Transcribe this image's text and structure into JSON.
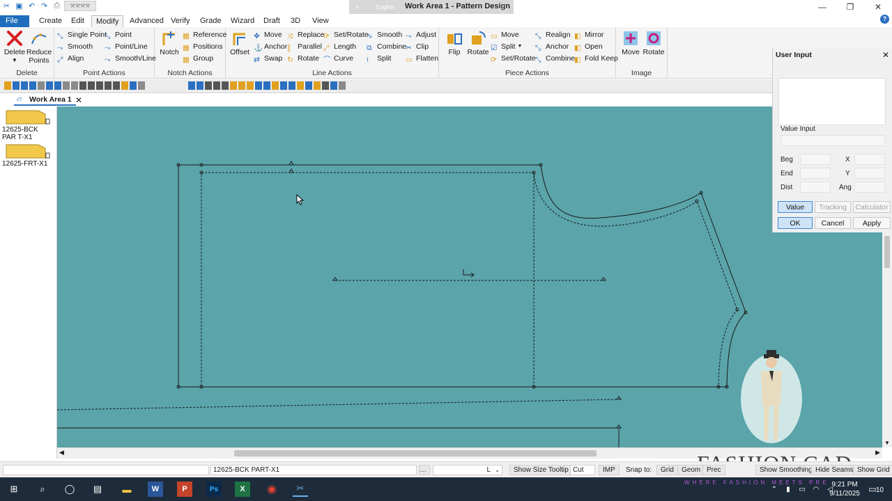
{
  "window": {
    "title": "Work Area 1 - Pattern Design",
    "language": "English",
    "controls": [
      "—",
      "❐",
      "✕"
    ]
  },
  "menu": {
    "tabs": [
      "File",
      "Create",
      "Edit",
      "Modify",
      "Advanced",
      "Verify",
      "Grade",
      "Wizard",
      "Draft",
      "3D",
      "View"
    ],
    "active": "Modify"
  },
  "ribbon": {
    "delete": {
      "label": "Delete",
      "buttons": {
        "delete": "Delete",
        "reduce_points": "Reduce Points"
      }
    },
    "point_actions": {
      "label": "Point Actions",
      "items": [
        "Single Point",
        "Point",
        "Smooth",
        "Point/Line",
        "Align",
        "Smooth/Line"
      ]
    },
    "notch_actions": {
      "label": "Notch Actions",
      "notch": "Notch",
      "items": [
        "Reference",
        "Positions",
        "Group"
      ]
    },
    "line_actions": {
      "label": "Line Actions",
      "offset": "Offset",
      "items": [
        "Move",
        "Replace",
        "Set/Rotate",
        "Smooth",
        "Adjust",
        "Anchor",
        "Parallel",
        "Length",
        "Combine",
        "Clip",
        "Swap",
        "Rotate",
        "Curve",
        "Split",
        "Flatten"
      ]
    },
    "piece_actions": {
      "label": "Piece Actions",
      "flip": "Flip",
      "rotate": "Rotate",
      "items": [
        "Move",
        "Realign",
        "Mirror",
        "Split",
        "Anchor",
        "Open",
        "Set/Rotate",
        "Combine",
        "Fold Keep"
      ]
    },
    "image": {
      "label": "Image",
      "move": "Move",
      "rotate": "Rotate"
    }
  },
  "work_area": {
    "tab_label": "Work Area 1"
  },
  "pieces": [
    {
      "label": "12625-BCK PAR T-X1"
    },
    {
      "label": "12625-FRT-X1"
    }
  ],
  "user_input": {
    "title": "User Input",
    "value_input_label": "Value Input",
    "fields": {
      "beg": "Beg",
      "end": "End",
      "dist": "Dist",
      "x": "X",
      "y": "Y",
      "ang": "Ang"
    },
    "modes": {
      "value": "Value",
      "tracking": "Tracking",
      "calculator": "Calculator"
    },
    "buttons": {
      "ok": "OK",
      "cancel": "Cancel",
      "apply": "Apply"
    }
  },
  "statusbar": {
    "piece_name": "12625-BCK PART-X1",
    "size_value": "L",
    "show_size_tooltip": "Show Size Tooltip",
    "cut": "Cut",
    "unit": "IMP",
    "snap_to": "Snap to:",
    "grid": "Grid",
    "geom": "Geom",
    "prec": "Prec",
    "show_smoothing": "Show Smoothing",
    "hide_seams": "Hide Seams",
    "show_grid": "Show Grid"
  },
  "taskbar": {
    "time": "9:21 PM",
    "date": "9/11/2025",
    "notifications": "10"
  },
  "watermark": {
    "brand": "FASHION CAD",
    "tagline": "WHERE FASHION MEETS PRE"
  },
  "colors": {
    "canvas_bg": "#5aa4aa",
    "file_tab": "#1f6ebd",
    "taskbar": "#1e2b3a"
  }
}
